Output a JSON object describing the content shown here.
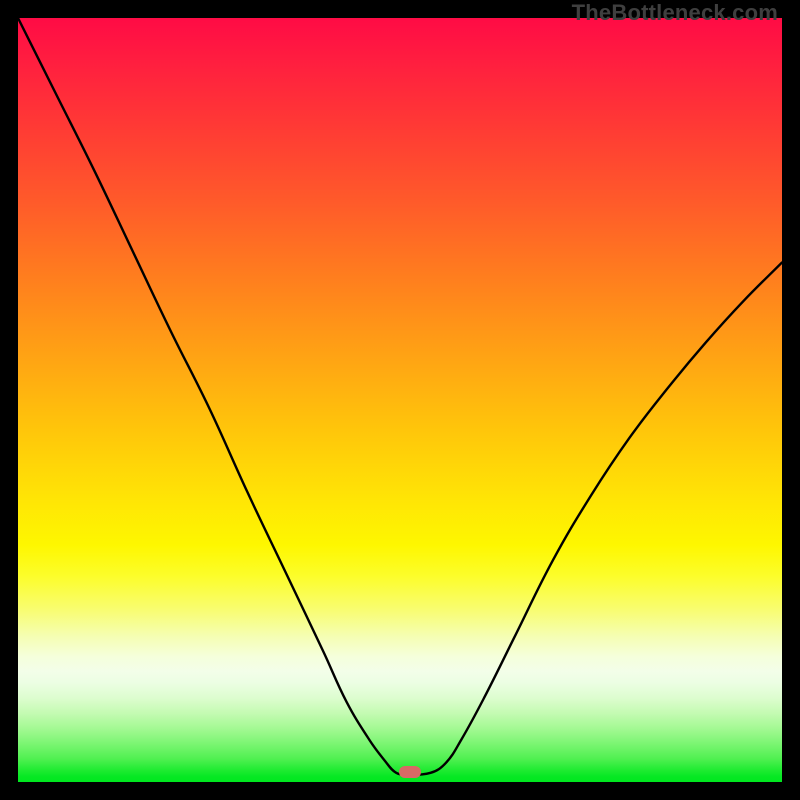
{
  "watermark": "TheBottleneck.com",
  "marker": {
    "x_frac": 0.513,
    "y_frac": 0.987
  },
  "chart_data": {
    "type": "line",
    "title": "",
    "xlabel": "",
    "ylabel": "",
    "xlim": [
      0,
      1
    ],
    "ylim": [
      0,
      1
    ],
    "series": [
      {
        "name": "bottleneck-curve",
        "x": [
          0.0,
          0.05,
          0.1,
          0.15,
          0.2,
          0.25,
          0.3,
          0.35,
          0.4,
          0.43,
          0.46,
          0.48,
          0.495,
          0.51,
          0.54,
          0.56,
          0.58,
          0.61,
          0.65,
          0.7,
          0.75,
          0.8,
          0.85,
          0.9,
          0.95,
          1.0
        ],
        "y": [
          1.0,
          0.9,
          0.8,
          0.695,
          0.59,
          0.49,
          0.38,
          0.275,
          0.17,
          0.105,
          0.055,
          0.028,
          0.012,
          0.01,
          0.012,
          0.025,
          0.055,
          0.11,
          0.19,
          0.29,
          0.375,
          0.45,
          0.515,
          0.575,
          0.63,
          0.68
        ]
      }
    ],
    "background_gradient": {
      "top_color": "#ff0b45",
      "mid_color": "#ffe505",
      "bottom_color": "#00e71f"
    }
  }
}
